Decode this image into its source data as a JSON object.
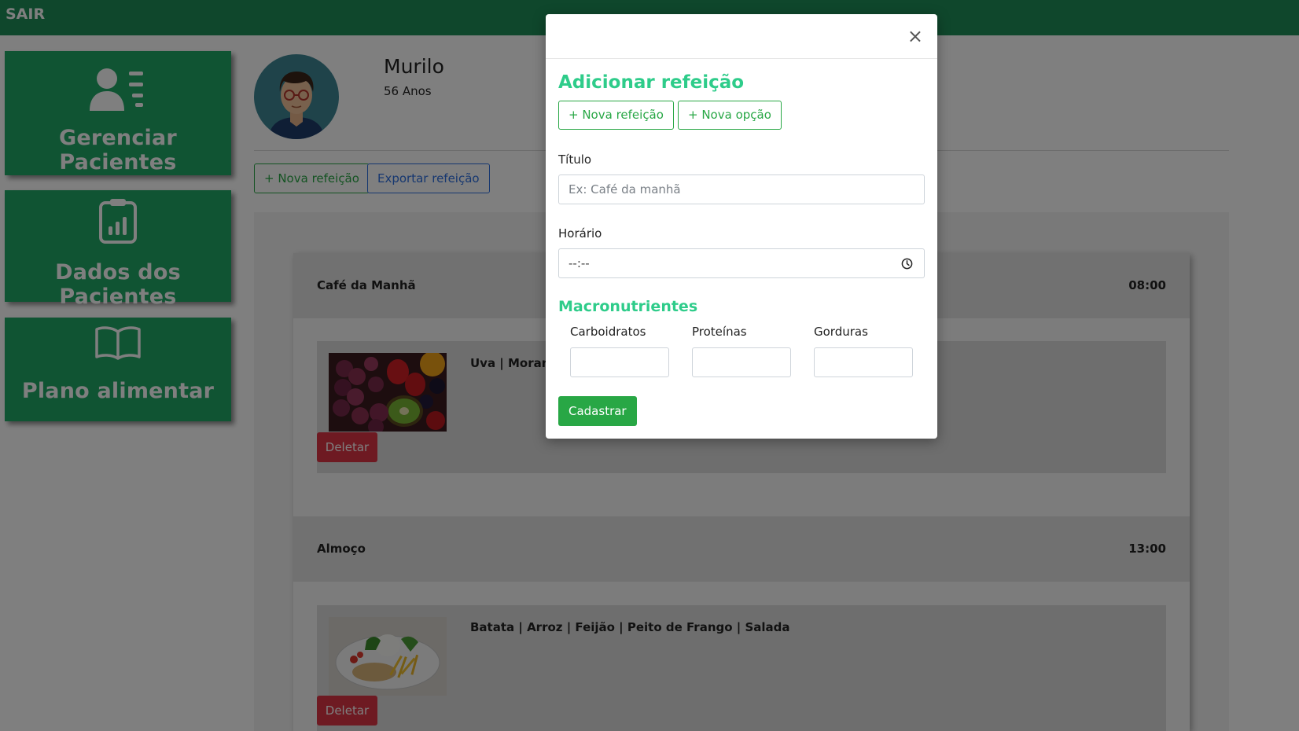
{
  "topbar": {
    "logout_label": "SAIR"
  },
  "sidebar": {
    "items": [
      {
        "label": "Gerenciar Pacientes",
        "icon": "user-list-icon"
      },
      {
        "label": "Dados dos Pacientes",
        "icon": "clipboard-chart-icon"
      },
      {
        "label": "Plano alimentar",
        "icon": "open-book-icon"
      }
    ]
  },
  "patient": {
    "name": "Murilo",
    "age": "56 Anos"
  },
  "actions": {
    "new_meal": "+ Nova refeição",
    "export_meal": "Exportar refeição"
  },
  "meals": [
    {
      "title": "Café da Manhã",
      "time": "08:00",
      "foods": "Uva | Morango | Kiwi | Laranja",
      "delete_label": "Deletar"
    },
    {
      "title": "Almoço",
      "time": "13:00",
      "foods": "Batata | Arroz | Feijão | Peito de Frango | Salada",
      "delete_label": "Deletar"
    }
  ],
  "modal": {
    "close_label": "×",
    "title": "Adicionar refeição",
    "new_meal_button": "+ Nova refeição",
    "new_option_button": "+ Nova opção",
    "title_label": "Título",
    "title_placeholder": "Ex: Café da manhã",
    "time_label": "Horário",
    "time_value": "--:--",
    "macros_heading": "Macronutrientes",
    "macros": [
      "Carboidratos",
      "Proteínas",
      "Gorduras"
    ],
    "submit_label": "Cadastrar"
  },
  "colors": {
    "brand_green": "#1e8f58",
    "card_green": "#20a866",
    "accent_green": "#2ecc8a",
    "success": "#28a745",
    "danger": "#dc3545",
    "link_blue": "#2c6fe0"
  }
}
